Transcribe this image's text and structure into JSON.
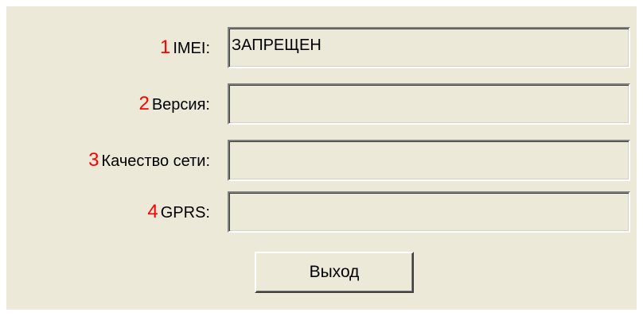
{
  "fields": [
    {
      "number": "1",
      "label": "IMEI:",
      "value": "ЗАПРЕЩЕН"
    },
    {
      "number": "2",
      "label": "Версия:",
      "value": ""
    },
    {
      "number": "3",
      "label": "Качество сети:",
      "value": ""
    },
    {
      "number": "4",
      "label": "GPRS:",
      "value": ""
    }
  ],
  "exit_button": {
    "label": "Выход"
  },
  "colors": {
    "dialog_background": "#ece9d8",
    "annotation_number": "#ff0000"
  }
}
